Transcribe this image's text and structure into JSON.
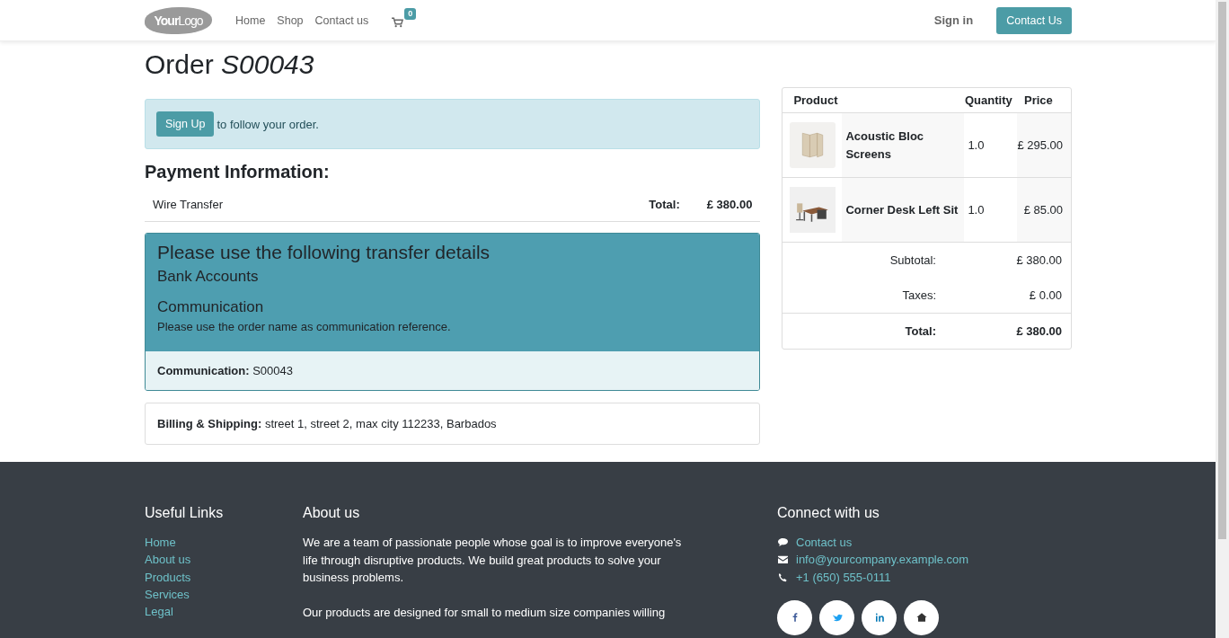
{
  "navbar": {
    "logo": {
      "bold": "Your",
      "light": "Logo"
    },
    "links": [
      {
        "label": "Home"
      },
      {
        "label": "Shop"
      },
      {
        "label": "Contact us"
      }
    ],
    "cart_count": "0",
    "sign_in": "Sign in",
    "contact_button": "Contact Us"
  },
  "order": {
    "title": "Order",
    "number": "S00043"
  },
  "signup_alert": {
    "button": "Sign Up",
    "text": "to follow your order."
  },
  "payment": {
    "heading": "Payment Information:",
    "method": "Wire Transfer",
    "total_label": "Total:",
    "total_value": "£ 380.00"
  },
  "transfer": {
    "heading": "Please use the following transfer details",
    "bank_heading": "Bank Accounts",
    "communication_heading": "Communication",
    "note": "Please use the order name as communication reference.",
    "communication_label": "Communication:",
    "communication_value": "S00043"
  },
  "address": {
    "label": "Billing & Shipping:",
    "value": "street 1, street 2, max city 112233, Barbados"
  },
  "summary": {
    "columns": [
      "Product",
      "Quantity",
      "Price"
    ],
    "rows": [
      {
        "product": "Acoustic Bloc Screens",
        "kind": "screen",
        "quantity": "1.0",
        "price": "£ 295.00"
      },
      {
        "product": "Corner Desk Left Sit",
        "kind": "desk",
        "quantity": "1.0",
        "price": "£ 85.00"
      }
    ],
    "totals": [
      {
        "label": "Subtotal:",
        "value": "£ 380.00",
        "kind": "normal"
      },
      {
        "label": "Taxes:",
        "value": "£ 0.00",
        "kind": "normal"
      },
      {
        "label": "Total:",
        "value": "£ 380.00",
        "kind": "grand"
      }
    ]
  },
  "footer": {
    "links_heading": "Useful Links",
    "links": [
      "Home",
      "About us",
      "Products",
      "Services",
      "Legal"
    ],
    "about_heading": "About us",
    "about_paragraphs": [
      "We are a team of passionate people whose goal is to improve everyone's life through disruptive products. We build great products to solve your business problems.",
      "Our products are designed for small to medium size companies willing"
    ],
    "connect_heading": "Connect with us",
    "contacts": [
      {
        "kind": "chat",
        "text": "Contact us"
      },
      {
        "kind": "mail",
        "text": "info@yourcompany.example.com"
      },
      {
        "kind": "phone",
        "text": "+1 (650) 555-0111"
      }
    ],
    "social": [
      {
        "kind": "facebook"
      },
      {
        "kind": "twitter"
      },
      {
        "kind": "linkedin"
      },
      {
        "kind": "home"
      }
    ]
  }
}
